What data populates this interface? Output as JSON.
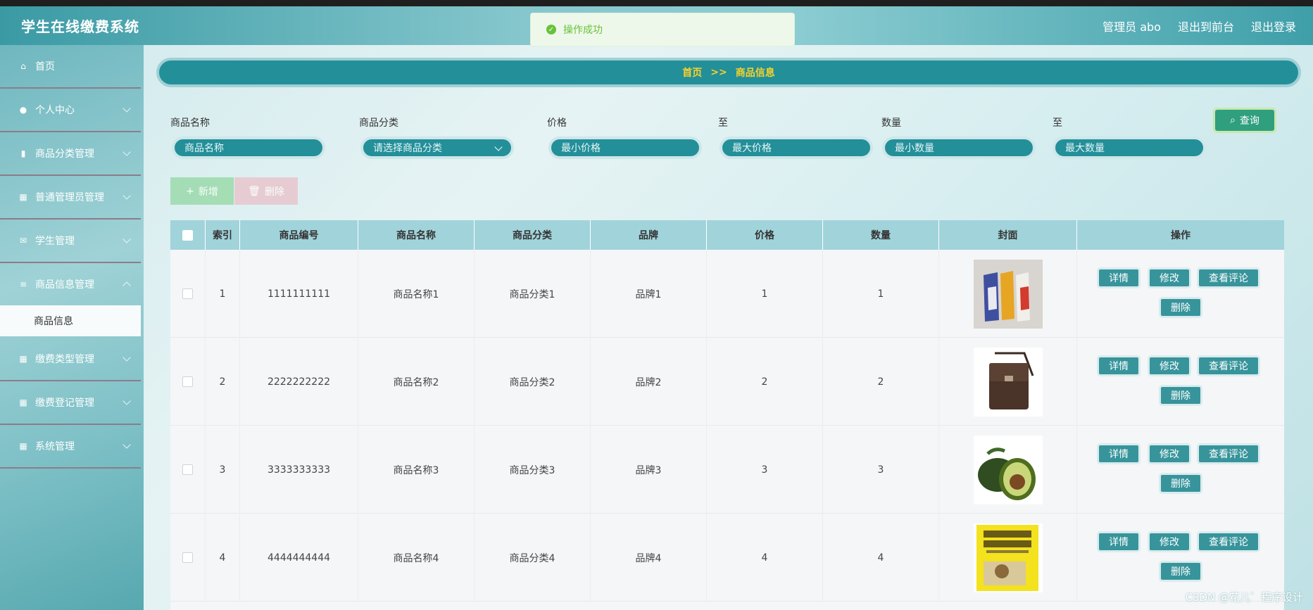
{
  "app": {
    "title": "学生在线缴费系统",
    "header_links": [
      "管理员 abo",
      "退出到前台",
      "退出登录"
    ],
    "toast": "操作成功"
  },
  "sidebar": {
    "items": [
      {
        "label": "首页",
        "icon": "home-icon"
      },
      {
        "label": "个人中心",
        "icon": "user-icon"
      },
      {
        "label": "商品分类管理",
        "icon": "bar-chart-icon"
      },
      {
        "label": "普通管理员管理",
        "icon": "grid-icon"
      },
      {
        "label": "学生管理",
        "icon": "ticket-icon"
      },
      {
        "label": "商品信息管理",
        "icon": "list-icon"
      },
      {
        "label": "缴费类型管理",
        "icon": "grid-icon"
      },
      {
        "label": "缴费登记管理",
        "icon": "grid-icon"
      },
      {
        "label": "系统管理",
        "icon": "grid-icon"
      }
    ],
    "active_sub": "商品信息"
  },
  "breadcrumb": {
    "home": "首页",
    "sep": ">>",
    "current": "商品信息"
  },
  "filters": {
    "labels": [
      "商品名称",
      "商品分类",
      "价格",
      "至",
      "数量",
      "至"
    ],
    "placeholders": [
      "商品名称",
      "请选择商品分类",
      "最小价格",
      "最大价格",
      "最小数量",
      "最大数量"
    ],
    "query": "查询"
  },
  "actions": {
    "add": "新增",
    "delete": "删除"
  },
  "table": {
    "headers": [
      "索引",
      "商品编号",
      "商品名称",
      "商品分类",
      "品牌",
      "价格",
      "数量",
      "封面",
      "操作"
    ],
    "rows": [
      {
        "index": "1",
        "code": "1111111111",
        "name": "商品名称1",
        "category": "商品分类1",
        "brand": "品牌1",
        "price": "1",
        "qty": "1"
      },
      {
        "index": "2",
        "code": "2222222222",
        "name": "商品名称2",
        "category": "商品分类2",
        "brand": "品牌2",
        "price": "2",
        "qty": "2"
      },
      {
        "index": "3",
        "code": "3333333333",
        "name": "商品名称3",
        "category": "商品分类3",
        "brand": "品牌3",
        "price": "3",
        "qty": "3"
      },
      {
        "index": "4",
        "code": "4444444444",
        "name": "商品名称4",
        "category": "商品分类4",
        "brand": "品牌4",
        "price": "4",
        "qty": "4"
      }
    ],
    "row_ops": [
      "详情",
      "修改",
      "查看评论",
      "删除"
    ]
  },
  "watermark": "CSDN @花儿゛程序设计",
  "colors": {
    "accent": "#238f99",
    "breadcrumb_text": "#f7d32b",
    "success": "#67c23a",
    "op_button": "#37949b"
  }
}
